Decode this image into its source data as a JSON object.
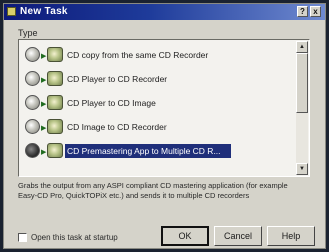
{
  "window": {
    "title": "New Task",
    "help_button": "?",
    "close_button": "x"
  },
  "type_label": "Type",
  "list": {
    "items": [
      {
        "label": "CD copy from the same CD Recorder",
        "selected": false
      },
      {
        "label": "CD Player to CD Recorder",
        "selected": false
      },
      {
        "label": "CD Player to CD Image",
        "selected": false
      },
      {
        "label": "CD Image to CD Recorder",
        "selected": false
      },
      {
        "label": "CD Premastering App to Multiple CD R...",
        "selected": true
      }
    ],
    "scroll_up": "▲",
    "scroll_down": "▼"
  },
  "description": "Grabs the output from any ASPI compliant CD mastering application (for example Easy-CD Pro, QuickTOPiX etc.) and sends it to multiple CD recorders",
  "open_checkbox": {
    "label": "Open this task at startup",
    "checked": false
  },
  "buttons": {
    "ok": "OK",
    "cancel": "Cancel",
    "help": "Help"
  },
  "colors": {
    "title_bar": "#0d1a7a",
    "selection": "#1f2f7a",
    "dialog_bg": "#d5d3ca"
  }
}
